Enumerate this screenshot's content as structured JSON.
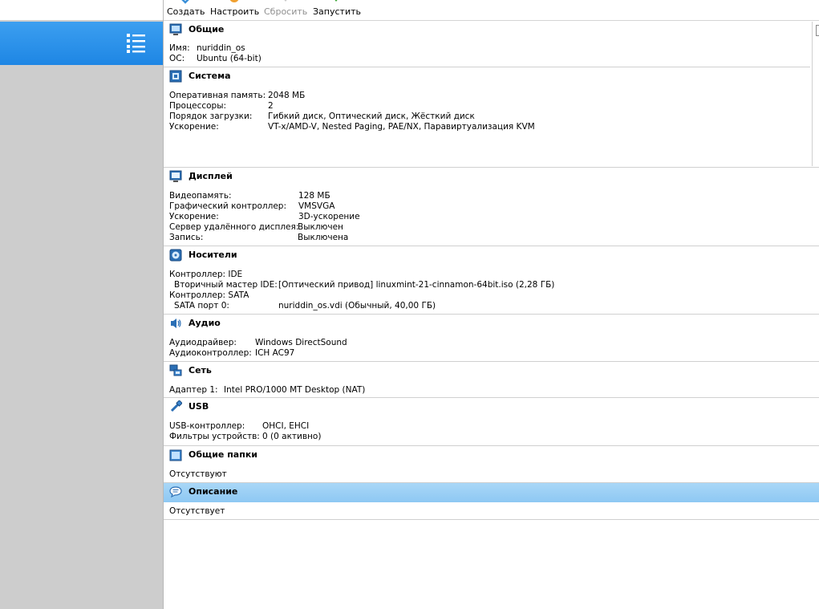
{
  "toolbar": {
    "create_label": "Создать",
    "settings_label": "Настроить",
    "discard_label": "Сбросить",
    "start_label": "Запустить"
  },
  "sections": {
    "general": {
      "title": "Общие",
      "rows": [
        {
          "label": "Имя:",
          "value": "nuriddin_os"
        },
        {
          "label": "ОС:",
          "value": "Ubuntu (64-bit)"
        }
      ]
    },
    "system": {
      "title": "Система",
      "rows": [
        {
          "label": "Оперативная память:",
          "value": "2048 МБ"
        },
        {
          "label": "Процессоры:",
          "value": "2"
        },
        {
          "label": "Порядок загрузки:",
          "value": "Гибкий диск, Оптический диск, Жёсткий диск"
        },
        {
          "label": "Ускорение:",
          "value": "VT-x/AMD-V, Nested Paging, PAE/NX, Паравиртуализация KVM"
        }
      ]
    },
    "display": {
      "title": "Дисплей",
      "rows": [
        {
          "label": "Видеопамять:",
          "value": "128 МБ"
        },
        {
          "label": "Графический контроллер:",
          "value": "VMSVGA"
        },
        {
          "label": "Ускорение:",
          "value": "3D-ускорение"
        },
        {
          "label": "Сервер удалённого дисплея:",
          "value": "Выключен"
        },
        {
          "label": "Запись:",
          "value": "Выключена"
        }
      ]
    },
    "storage": {
      "title": "Носители",
      "controller_ide": "Контроллер: IDE",
      "ide_port_label": "Вторичный мастер IDE:",
      "ide_port_value": "[Оптический привод] linuxmint-21-cinnamon-64bit.iso (2,28 ГБ)",
      "controller_sata": "Контроллер: SATA",
      "sata_port_label": "SATA порт 0:",
      "sata_port_value": "nuriddin_os.vdi (Обычный, 40,00 ГБ)"
    },
    "audio": {
      "title": "Аудио",
      "rows": [
        {
          "label": "Аудиодрайвер:",
          "value": "Windows DirectSound"
        },
        {
          "label": "Аудиоконтроллер:",
          "value": "ICH AC97"
        }
      ]
    },
    "network": {
      "title": "Сеть",
      "rows": [
        {
          "label": "Адаптер 1:",
          "value": "Intel PRO/1000 MT Desktop (NAT)"
        }
      ]
    },
    "usb": {
      "title": "USB",
      "rows": [
        {
          "label": "USB-контроллер:",
          "value": "OHCI, EHCI"
        },
        {
          "label": "Фильтры устройств:",
          "value": "0 (0 активно)"
        }
      ]
    },
    "shared_folders": {
      "title": "Общие папки",
      "text": "Отсутствуют"
    },
    "description": {
      "title": "Описание",
      "text": "Отсутствует"
    }
  },
  "colors": {
    "selection_blue": "#1e86e4",
    "description_highlight": "#9fd1f5",
    "sidebar_gray": "#cdcdcd"
  },
  "icons": {
    "tools": "list-icon",
    "general": "monitor-icon",
    "system": "chip-icon",
    "display": "monitor-icon",
    "storage": "disk-icon",
    "audio": "speaker-icon",
    "network": "network-icon",
    "usb": "usb-icon",
    "shared_folders": "folder-icon",
    "description": "speech-bubble-icon"
  }
}
